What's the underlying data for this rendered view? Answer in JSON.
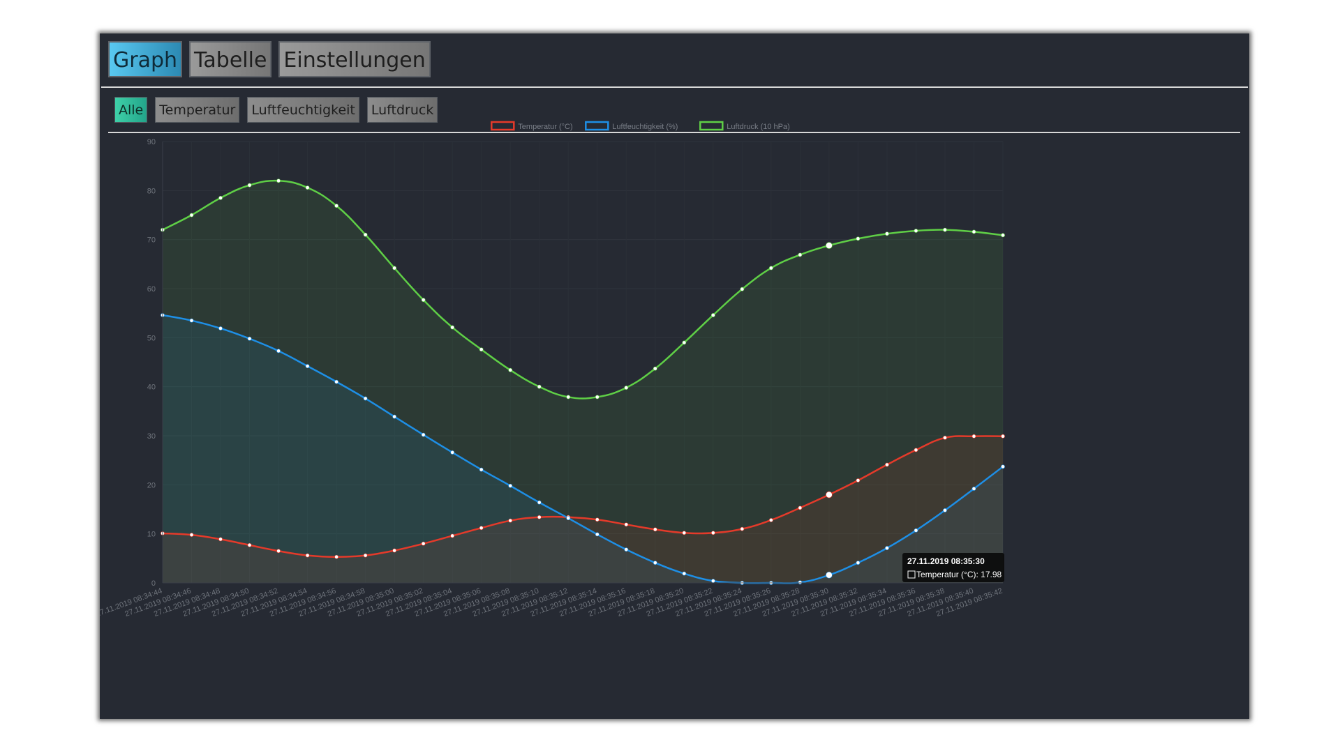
{
  "tabs": [
    {
      "label": "Graph",
      "active": true
    },
    {
      "label": "Tabelle",
      "active": false
    },
    {
      "label": "Einstellungen",
      "active": false
    }
  ],
  "subtabs": [
    {
      "label": "Alle",
      "active": true
    },
    {
      "label": "Temperatur",
      "active": false
    },
    {
      "label": "Luftfeuchtigkeit",
      "active": false
    },
    {
      "label": "Luftdruck",
      "active": false
    }
  ],
  "colors": {
    "window_bg": "#262a33",
    "tab_active": "#4fbfe6",
    "subtab_active": "#2fbf99",
    "temperature": "#e53a2a",
    "humidity": "#1e8fe6",
    "pressure": "#5fcf46"
  },
  "tooltip": {
    "title": "27.11.2019 08:35:30",
    "body": "Temperatur (°C): 17.98",
    "index": 23
  },
  "chart_data": {
    "type": "line",
    "smooth": true,
    "filled": true,
    "grid": true,
    "legend_position": "top",
    "ylim": [
      0,
      90
    ],
    "yticks": [
      0,
      10,
      20,
      30,
      40,
      50,
      60,
      70,
      80,
      90
    ],
    "categories": [
      "27.11.2019 08:34:44",
      "27.11.2019 08:34:46",
      "27.11.2019 08:34:48",
      "27.11.2019 08:34:50",
      "27.11.2019 08:34:52",
      "27.11.2019 08:34:54",
      "27.11.2019 08:34:56",
      "27.11.2019 08:34:58",
      "27.11.2019 08:35:00",
      "27.11.2019 08:35:02",
      "27.11.2019 08:35:04",
      "27.11.2019 08:35:06",
      "27.11.2019 08:35:08",
      "27.11.2019 08:35:10",
      "27.11.2019 08:35:12",
      "27.11.2019 08:35:14",
      "27.11.2019 08:35:16",
      "27.11.2019 08:35:18",
      "27.11.2019 08:35:20",
      "27.11.2019 08:35:22",
      "27.11.2019 08:35:24",
      "27.11.2019 08:35:26",
      "27.11.2019 08:35:28",
      "27.11.2019 08:35:30",
      "27.11.2019 08:35:32",
      "27.11.2019 08:35:34",
      "27.11.2019 08:35:36",
      "27.11.2019 08:35:38",
      "27.11.2019 08:35:40",
      "27.11.2019 08:35:42"
    ],
    "series": [
      {
        "name": "Temperatur (°C)",
        "color": "#e53a2a",
        "values": [
          10.1,
          9.8,
          8.9,
          7.7,
          6.5,
          5.6,
          5.3,
          5.6,
          6.6,
          8.0,
          9.6,
          11.2,
          12.7,
          13.4,
          13.4,
          12.9,
          11.9,
          10.9,
          10.2,
          10.2,
          11.0,
          12.8,
          15.3,
          17.98,
          20.9,
          24.1,
          27.1,
          29.6,
          29.9,
          29.9
        ]
      },
      {
        "name": "Luftfeuchtigkeit (%)",
        "color": "#1e8fe6",
        "values": [
          54.6,
          53.5,
          51.9,
          49.8,
          47.3,
          44.2,
          41.0,
          37.6,
          33.9,
          30.2,
          26.6,
          23.1,
          19.8,
          16.4,
          13.2,
          9.9,
          6.8,
          4.1,
          1.9,
          0.4,
          0.0,
          0.0,
          0.1,
          1.6,
          4.1,
          7.1,
          10.7,
          14.8,
          19.2,
          23.7
        ]
      },
      {
        "name": "Luftdruck (10 hPa)",
        "color": "#5fcf46",
        "values": [
          72.0,
          75.0,
          78.5,
          81.1,
          82.0,
          80.6,
          76.9,
          71.0,
          64.2,
          57.7,
          52.1,
          47.6,
          43.4,
          40.0,
          37.9,
          37.9,
          39.8,
          43.7,
          49.0,
          54.6,
          59.9,
          64.2,
          66.9,
          68.8,
          70.2,
          71.2,
          71.8,
          72.0,
          71.6,
          70.9
        ]
      }
    ]
  }
}
